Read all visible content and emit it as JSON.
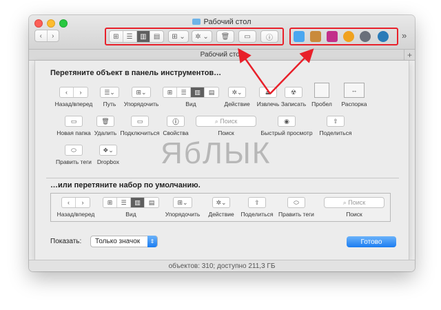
{
  "window": {
    "title": "Рабочий стол",
    "tab_title": "Рабочий стол",
    "status_text": "объектов: 310; доступно 211,3 ГБ",
    "more_glyph": "»",
    "add_tab_glyph": "+"
  },
  "toolbar": {
    "back_glyph": "‹",
    "forward_glyph": "›",
    "view_glyphs": [
      "⊞",
      "☰",
      "▥",
      "▤"
    ],
    "arrange_glyph": "⊞ ⌄",
    "action_glyph": "✲ ⌄",
    "trash_glyph": "🗑",
    "folder_glyph": "▭",
    "info_glyph": "ⓘ"
  },
  "app_icons": [
    {
      "name": "dropbox",
      "color": "#4aa7f0"
    },
    {
      "name": "preview",
      "color": "#c98a3b"
    },
    {
      "name": "screen-sharing",
      "color": "#c22f8a"
    },
    {
      "name": "orange-app",
      "color": "#f0a21e"
    },
    {
      "name": "rocket-app",
      "color": "#6a6f7a"
    },
    {
      "name": "quicktime",
      "color": "#2a7bb8"
    }
  ],
  "sheet": {
    "heading": "Перетяните объект в панель инструментов…",
    "items": {
      "back_forward": "Назад/вперед",
      "path": "Путь",
      "arrange": "Упорядочить",
      "view": "Вид",
      "action": "Действие",
      "eject": "Извлечь",
      "burn": "Записать",
      "space": "Пробел",
      "flex_space": "Распорка",
      "new_folder": "Новая папка",
      "delete": "Удалить",
      "connect": "Подключиться",
      "info": "Свойства",
      "search": "Поиск",
      "search_placeholder": "Поиск",
      "quick_look": "Быстрый просмотр",
      "share": "Поделиться",
      "edit_tags": "Править теги",
      "dropbox": "Dropbox"
    },
    "default_heading": "…или перетяните набор по умолчанию.",
    "default_set": {
      "back_forward": "Назад/вперед",
      "view": "Вид",
      "arrange": "Упорядочить",
      "action": "Действие",
      "share": "Поделиться",
      "edit_tags": "Править теги",
      "search": "Поиск",
      "search_placeholder": "Поиск"
    },
    "show_label": "Показать:",
    "show_value": "Только значок",
    "done_button": "Готово"
  },
  "watermark": "ЯбЛЫК",
  "colors": {
    "annotation_red": "#e8202a",
    "accent_blue": "#1b7cf1"
  }
}
